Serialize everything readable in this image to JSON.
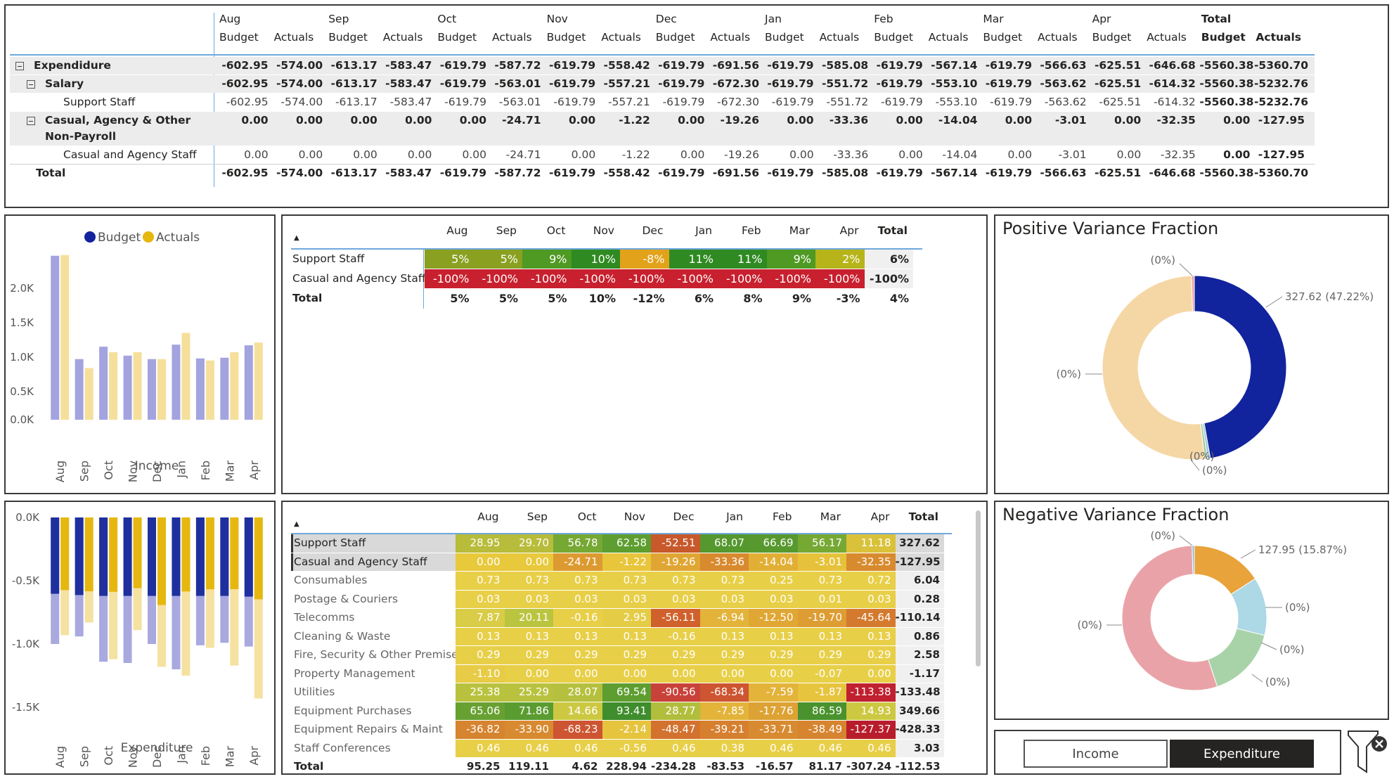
{
  "matrix": {
    "months": [
      "Aug",
      "Sep",
      "Oct",
      "Nov",
      "Dec",
      "Jan",
      "Feb",
      "Mar",
      "Apr"
    ],
    "total_label": "Total",
    "budget_label": "Budget",
    "actuals_label": "Actuals",
    "rows": [
      {
        "label": "Expendidure",
        "level": 0,
        "bold": true,
        "toggle": true,
        "band": true,
        "values": [
          "-602.95",
          "-574.00",
          "-613.17",
          "-583.47",
          "-619.79",
          "-587.72",
          "-619.79",
          "-558.42",
          "-619.79",
          "-691.56",
          "-619.79",
          "-585.08",
          "-619.79",
          "-567.14",
          "-619.79",
          "-566.63",
          "-625.51",
          "-646.68",
          "-5560.38",
          "-5360.70"
        ]
      },
      {
        "label": "Salary",
        "level": 1,
        "bold": true,
        "toggle": true,
        "band": true,
        "values": [
          "-602.95",
          "-574.00",
          "-613.17",
          "-583.47",
          "-619.79",
          "-563.01",
          "-619.79",
          "-557.21",
          "-619.79",
          "-672.30",
          "-619.79",
          "-551.72",
          "-619.79",
          "-553.10",
          "-619.79",
          "-563.62",
          "-625.51",
          "-614.32",
          "-5560.38",
          "-5232.76"
        ]
      },
      {
        "label": "Support Staff",
        "level": 2,
        "bold": false,
        "toggle": false,
        "band": false,
        "values": [
          "-602.95",
          "-574.00",
          "-613.17",
          "-583.47",
          "-619.79",
          "-563.01",
          "-619.79",
          "-557.21",
          "-619.79",
          "-672.30",
          "-619.79",
          "-551.72",
          "-619.79",
          "-553.10",
          "-619.79",
          "-563.62",
          "-625.51",
          "-614.32",
          "-5560.38",
          "-5232.76"
        ]
      },
      {
        "label": "Casual, Agency & Other",
        "label2": "Non-Payroll",
        "level": 1,
        "bold": true,
        "toggle": true,
        "band": true,
        "values": [
          "0.00",
          "0.00",
          "0.00",
          "0.00",
          "0.00",
          "-24.71",
          "0.00",
          "-1.22",
          "0.00",
          "-19.26",
          "0.00",
          "-33.36",
          "0.00",
          "-14.04",
          "0.00",
          "-3.01",
          "0.00",
          "-32.35",
          "0.00",
          "-127.95"
        ]
      },
      {
        "label": "Casual and Agency Staff",
        "level": 2,
        "bold": false,
        "toggle": false,
        "band": false,
        "values": [
          "0.00",
          "0.00",
          "0.00",
          "0.00",
          "0.00",
          "-24.71",
          "0.00",
          "-1.22",
          "0.00",
          "-19.26",
          "0.00",
          "-33.36",
          "0.00",
          "-14.04",
          "0.00",
          "-3.01",
          "0.00",
          "-32.35",
          "0.00",
          "-127.95"
        ]
      },
      {
        "label": "Total",
        "level": 0,
        "bold": true,
        "toggle": false,
        "band": false,
        "values": [
          "-602.95",
          "-574.00",
          "-613.17",
          "-583.47",
          "-619.79",
          "-587.72",
          "-619.79",
          "-558.42",
          "-619.79",
          "-691.56",
          "-619.79",
          "-585.08",
          "-619.79",
          "-567.14",
          "-619.79",
          "-566.63",
          "-625.51",
          "-646.68",
          "-5560.38",
          "-5360.70"
        ]
      }
    ]
  },
  "chart_data": [
    {
      "type": "bar",
      "xlabel": "Income",
      "legend": [
        "Budget",
        "Actuals"
      ],
      "legend_position": "top",
      "categories": [
        "Aug",
        "Sep",
        "Oct",
        "Nov",
        "Dec",
        "Jan",
        "Feb",
        "Mar",
        "Apr"
      ],
      "series": [
        {
          "name": "Budget",
          "color": "#a3a3df",
          "values": [
            2380,
            880,
            1060,
            930,
            880,
            1090,
            890,
            900,
            1080
          ]
        },
        {
          "name": "Actuals",
          "color": "#f5df9a",
          "values": [
            2390,
            750,
            980,
            980,
            880,
            1260,
            860,
            980,
            1120
          ]
        }
      ],
      "yticks": [
        "2.0K",
        "1.5K",
        "1.0K",
        "0.5K",
        "0.0K"
      ],
      "ylim": [
        0,
        2600
      ]
    },
    {
      "type": "bar",
      "xlabel": "Expenditure",
      "categories": [
        "Aug",
        "Sep",
        "Oct",
        "Nov",
        "Dec",
        "Jan",
        "Feb",
        "Mar",
        "Apr"
      ],
      "series": [
        {
          "name": "Budget",
          "color": "#1f2f9e",
          "values": [
            -602.95,
            -613.17,
            -619.79,
            -619.79,
            -619.79,
            -619.79,
            -619.79,
            -619.79,
            -625.51
          ]
        },
        {
          "name": "Actuals",
          "color": "#e6b70f",
          "values": [
            -574.0,
            -583.47,
            -587.72,
            -558.42,
            -691.56,
            -585.08,
            -567.14,
            -566.63,
            -646.68
          ]
        },
        {
          "name": "Budget",
          "color": "#a9a9e0",
          "values": [
            -1000,
            -940,
            -1140,
            -1150,
            -1000,
            -1200,
            -1010,
            -990,
            -1020
          ]
        },
        {
          "name": "Actuals",
          "color": "#f5e1a0",
          "values": [
            -930,
            -830,
            -1120,
            -890,
            -1180,
            -1250,
            -1030,
            -1170,
            -1430
          ]
        }
      ],
      "yticks": [
        "0.0K",
        "-0.5K",
        "-1.0K",
        "-1.5K"
      ],
      "ylim": [
        -1650,
        0
      ]
    },
    {
      "type": "pie",
      "title": "Positive Variance Fraction",
      "slices": [
        {
          "label": "327.62 (47.22%)",
          "value": 47.22,
          "color": "#12239e"
        },
        {
          "label": "(0%)",
          "value": 0.5,
          "color": "#9fc6dc"
        },
        {
          "label": "(0%)",
          "value": 0.5,
          "color": "#9ecb9e"
        },
        {
          "label": "(0%)",
          "value": 51.28,
          "color": "#f5d7a6"
        },
        {
          "label": "(0%)",
          "value": 0.5,
          "color": "#e9a3a8"
        }
      ]
    },
    {
      "type": "pie",
      "title": "Negative Variance Fraction",
      "slices": [
        {
          "label": "127.95 (15.87%)",
          "value": 15.87,
          "color": "#e8a33a"
        },
        {
          "label": "(0%)",
          "value": 13,
          "color": "#add8e6"
        },
        {
          "label": "(0%)",
          "value": 16,
          "color": "#a8d3a8"
        },
        {
          "label": "(0%)",
          "value": 54.63,
          "color": "#e9a3a8"
        },
        {
          "label": "(0%)",
          "value": 0.5,
          "color": "#8fbcd4"
        }
      ]
    }
  ],
  "pct_table": {
    "months": [
      "Aug",
      "Sep",
      "Oct",
      "Nov",
      "Dec",
      "Jan",
      "Feb",
      "Mar",
      "Apr"
    ],
    "total_label": "Total",
    "rows": [
      {
        "label": "Support Staff",
        "values": [
          "5%",
          "5%",
          "9%",
          "10%",
          "-8%",
          "11%",
          "11%",
          "9%",
          "2%"
        ],
        "total": "6%",
        "colors": [
          "#8aa020",
          "#8aa020",
          "#4e9a22",
          "#2f8a22",
          "#e2a21a",
          "#2f8a22",
          "#2f8a22",
          "#4e9a22",
          "#b6b419"
        ]
      },
      {
        "label": "Casual and Agency Staff",
        "values": [
          "-100%",
          "-100%",
          "-100%",
          "-100%",
          "-100%",
          "-100%",
          "-100%",
          "-100%",
          "-100%"
        ],
        "total": "-100%",
        "colors": [
          "#c8202e",
          "#c8202e",
          "#c8202e",
          "#c8202e",
          "#c8202e",
          "#c8202e",
          "#c8202e",
          "#c8202e",
          "#c8202e"
        ]
      },
      {
        "label": "Total",
        "values": [
          "5%",
          "5%",
          "5%",
          "10%",
          "-12%",
          "6%",
          "8%",
          "9%",
          "-3%"
        ],
        "total": "4%",
        "colors": []
      }
    ]
  },
  "amt_table": {
    "months": [
      "Aug",
      "Sep",
      "Oct",
      "Nov",
      "Dec",
      "Jan",
      "Feb",
      "Mar",
      "Apr"
    ],
    "total_label": "Total",
    "rows": [
      {
        "label": "Support Staff",
        "values": [
          "28.95",
          "29.70",
          "56.78",
          "62.58",
          "-52.51",
          "68.07",
          "66.69",
          "56.17",
          "11.18"
        ],
        "total": "327.62",
        "selected": true,
        "colors": [
          "#b7bc3a",
          "#b7bc3a",
          "#76a834",
          "#5e9e30",
          "#c8592b",
          "#55982e",
          "#57992f",
          "#76a834",
          "#d9c23a"
        ]
      },
      {
        "label": "Casual and Agency Staff",
        "values": [
          "0.00",
          "0.00",
          "-24.71",
          "-1.22",
          "-19.26",
          "-33.36",
          "-14.04",
          "-3.01",
          "-32.35"
        ],
        "total": "-127.95",
        "selected": true,
        "colors": [
          "#e8c93c",
          "#e8c93c",
          "#dc9a30",
          "#e8c53a",
          "#e0a633",
          "#d88a2e",
          "#e2af35",
          "#e6c23a",
          "#d88b2e"
        ]
      },
      {
        "label": "Consumables",
        "values": [
          "0.73",
          "0.73",
          "0.73",
          "0.73",
          "0.73",
          "0.73",
          "0.25",
          "0.73",
          "0.72"
        ],
        "total": "6.04",
        "selected": false,
        "colors": [
          "#e8cf48",
          "#e8cf48",
          "#e8cf48",
          "#e8cf48",
          "#e8cf48",
          "#e8cf48",
          "#e8cf48",
          "#e8cf48",
          "#e8cf48"
        ]
      },
      {
        "label": "Postage & Couriers",
        "values": [
          "0.03",
          "0.03",
          "0.03",
          "0.03",
          "0.03",
          "0.03",
          "0.03",
          "0.01",
          "0.03"
        ],
        "total": "0.28",
        "selected": false,
        "colors": [
          "#e8cf48",
          "#e8cf48",
          "#e8cf48",
          "#e8cf48",
          "#e8cf48",
          "#e8cf48",
          "#e8cf48",
          "#e8cf48",
          "#e8cf48"
        ]
      },
      {
        "label": "Telecomms",
        "values": [
          "7.87",
          "20.11",
          "-0.16",
          "2.95",
          "-56.11",
          "-6.94",
          "-12.50",
          "-19.70",
          "-45.64"
        ],
        "total": "-110.14",
        "selected": false,
        "colors": [
          "#d9cc46",
          "#bbc43e",
          "#e8cf48",
          "#e4cc46",
          "#d0612c",
          "#e3b33a",
          "#e0a734",
          "#dd9d32",
          "#d47a2e"
        ]
      },
      {
        "label": "Cleaning & Waste",
        "values": [
          "0.13",
          "0.13",
          "0.13",
          "0.13",
          "-0.16",
          "0.13",
          "0.13",
          "0.13",
          "0.13"
        ],
        "total": "0.86",
        "selected": false,
        "colors": [
          "#e8cf48",
          "#e8cf48",
          "#e8cf48",
          "#e8cf48",
          "#e8cf48",
          "#e8cf48",
          "#e8cf48",
          "#e8cf48",
          "#e8cf48"
        ]
      },
      {
        "label": "Fire, Security & Other Premises",
        "values": [
          "0.29",
          "0.29",
          "0.29",
          "0.29",
          "0.29",
          "0.29",
          "0.29",
          "0.29",
          "0.29"
        ],
        "total": "2.58",
        "selected": false,
        "colors": [
          "#e8cf48",
          "#e8cf48",
          "#e8cf48",
          "#e8cf48",
          "#e8cf48",
          "#e8cf48",
          "#e8cf48",
          "#e8cf48",
          "#e8cf48"
        ]
      },
      {
        "label": "Property Management",
        "values": [
          "-1.10",
          "0.00",
          "0.00",
          "0.00",
          "0.00",
          "0.00",
          "0.00",
          "-0.07",
          "0.00"
        ],
        "total": "-1.17",
        "selected": false,
        "colors": [
          "#e8cb46",
          "#e8cf48",
          "#e8cf48",
          "#e8cf48",
          "#e8cf48",
          "#e8cf48",
          "#e8cf48",
          "#e8cf48",
          "#e8cf48"
        ]
      },
      {
        "label": "Utilities",
        "values": [
          "25.38",
          "25.29",
          "28.07",
          "69.54",
          "-90.56",
          "-68.34",
          "-7.59",
          "-1.87",
          "-113.38"
        ],
        "total": "-133.48",
        "selected": false,
        "colors": [
          "#b9c23e",
          "#b9c23e",
          "#b5c03e",
          "#5e9e30",
          "#c9423a",
          "#cd5531",
          "#e3b33a",
          "#e6c43e",
          "#c0202f"
        ]
      },
      {
        "label": "Equipment Purchases",
        "values": [
          "65.06",
          "71.86",
          "14.66",
          "93.41",
          "28.77",
          "-7.85",
          "-17.76",
          "86.59",
          "14.93"
        ],
        "total": "349.66",
        "selected": false,
        "colors": [
          "#68a032",
          "#5b9c30",
          "#cdc842",
          "#3f8d2c",
          "#b1be3d",
          "#e3b33a",
          "#dda234",
          "#4a922d",
          "#cdc842"
        ]
      },
      {
        "label": "Equipment Repairs & Maint",
        "values": [
          "-36.82",
          "-33.90",
          "-68.23",
          "-2.14",
          "-48.47",
          "-39.21",
          "-33.71",
          "-38.49",
          "-127.37"
        ],
        "total": "-428.33",
        "selected": false,
        "colors": [
          "#d6842f",
          "#d88a30",
          "#cd5531",
          "#e6c43e",
          "#d3712e",
          "#d67f2f",
          "#d88a30",
          "#d6842f",
          "#b81d2c"
        ]
      },
      {
        "label": "Staff Conferences",
        "values": [
          "0.46",
          "0.46",
          "0.46",
          "-0.56",
          "0.46",
          "0.38",
          "0.46",
          "0.46",
          "0.46"
        ],
        "total": "3.03",
        "selected": false,
        "colors": [
          "#e8cf48",
          "#e8cf48",
          "#e8cf48",
          "#e8cf48",
          "#e8cf48",
          "#e8cf48",
          "#e8cf48",
          "#e8cf48",
          "#e8cf48"
        ]
      },
      {
        "label": "Total",
        "values": [
          "95.25",
          "119.11",
          "4.62",
          "228.94",
          "-234.28",
          "-83.53",
          "-16.57",
          "81.17",
          "-307.24"
        ],
        "total": "-112.53",
        "selected": false,
        "colors": []
      }
    ]
  },
  "slicer": {
    "options": [
      "Income",
      "Expenditure"
    ],
    "selected": "Expenditure"
  },
  "colors": {
    "panel_border": "#3b3b3b",
    "matrix_band": "#ececec",
    "accent_line": "#6fa8dc"
  }
}
